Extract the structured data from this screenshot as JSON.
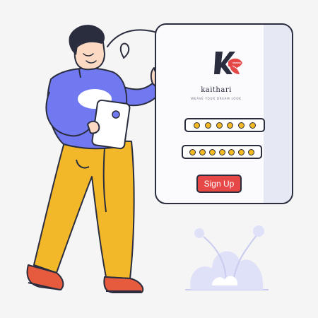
{
  "brand": {
    "name": "kaithari",
    "tagline": "WEAVE YOUR DREAM LOOK"
  },
  "form": {
    "password_fields": [
      {
        "masked_dots": 6
      },
      {
        "masked_dots": 7
      }
    ],
    "signup_label": "Sign Up"
  },
  "colors": {
    "background": "#f5f5f6",
    "outline": "#2a2d3e",
    "shirt": "#7179f0",
    "pants": "#f3b82a",
    "shoes": "#e65a3e",
    "accent_red": "#e64747",
    "dot_yellow": "#f3b91f",
    "plant": "#dfe1f8"
  },
  "icons": {
    "logo": "kaithari-logo-icon",
    "arrow": "curly-arrow-icon",
    "plant": "plant-decoration-icon"
  }
}
